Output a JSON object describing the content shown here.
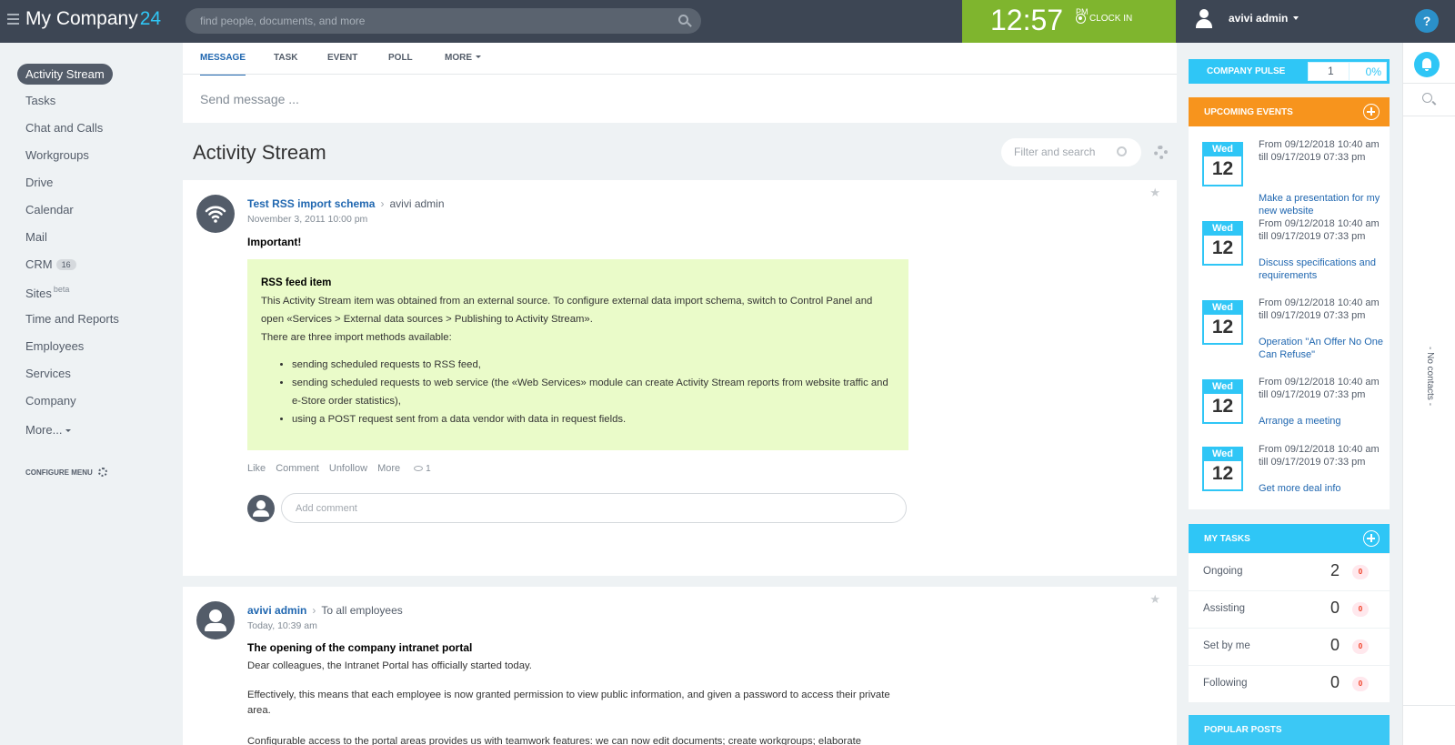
{
  "header": {
    "logo": "My Company",
    "logo_num": "24",
    "search_placeholder": "find people, documents, and more",
    "clock": {
      "time": "12:57",
      "ampm": "PM",
      "clock_in": "CLOCK IN"
    },
    "user_name": "avivi admin",
    "help": "?"
  },
  "menu": {
    "items": [
      {
        "label": "Activity Stream"
      },
      {
        "label": "Tasks"
      },
      {
        "label": "Chat and Calls"
      },
      {
        "label": "Workgroups"
      },
      {
        "label": "Drive"
      },
      {
        "label": "Calendar"
      },
      {
        "label": "Mail"
      },
      {
        "label": "CRM",
        "badge": "16"
      },
      {
        "label": "Sites",
        "sup": "beta"
      },
      {
        "label": "Time and Reports"
      },
      {
        "label": "Employees"
      },
      {
        "label": "Services"
      },
      {
        "label": "Company"
      },
      {
        "label": "More..."
      }
    ],
    "configure": "CONFIGURE MENU"
  },
  "composer": {
    "tabs": [
      "MESSAGE",
      "TASK",
      "EVENT",
      "POLL",
      "MORE"
    ],
    "placeholder": "Send message ..."
  },
  "stream": {
    "title": "Activity Stream",
    "filter_placeholder": "Filter and search"
  },
  "posts": [
    {
      "author": "Test RSS import schema",
      "recipient": "avivi admin",
      "date": "November 3, 2011 10:00 pm",
      "title": "Important!",
      "box_title": "RSS feed item",
      "box_text1": "This Activity Stream item was obtained from an external source. To configure external data import schema, switch to Control Panel and open «Services > External data sources > Publishing to Activity Stream».",
      "box_text2": "There are three import methods available:",
      "bullets": [
        "sending scheduled requests to RSS feed,",
        "sending scheduled requests to web service (the «Web Services» module can create Activity Stream reports from website traffic and e-Store order statistics),",
        "using a POST request sent from a data vendor with data in request fields."
      ],
      "actions": [
        "Like",
        "Comment",
        "Unfollow",
        "More"
      ],
      "views": "1",
      "comment_placeholder": "Add comment"
    },
    {
      "author": "avivi admin",
      "recipient": "To all employees",
      "date": "Today, 10:39 am",
      "title": "The opening of the company intranet portal",
      "para1": "Dear colleagues, the Intranet Portal has officially started today.",
      "para2": "Effectively, this means that each employee is now granted permission to view public information, and given a password to access their private area.",
      "para3": "Configurable access to the portal areas provides us with teamwork features: we can now edit documents; create workgroups; elaborate"
    }
  ],
  "right": {
    "pulse": {
      "label": "COMPANY PULSE",
      "value": "1",
      "percent": "0%"
    },
    "events_title": "UPCOMING EVENTS",
    "events": [
      {
        "day": "Wed",
        "num": "12",
        "when": "From 09/12/2018 10:40 am till 09/17/2019 07:33 pm",
        "title": "Make a presentation for my new website"
      },
      {
        "day": "Wed",
        "num": "12",
        "when": "From 09/12/2018 10:40 am till 09/17/2019 07:33 pm",
        "title": "Discuss specifications and requirements"
      },
      {
        "day": "Wed",
        "num": "12",
        "when": "From 09/12/2018 10:40 am till 09/17/2019 07:33 pm",
        "title": "Operation \"An Offer No One Can Refuse\""
      },
      {
        "day": "Wed",
        "num": "12",
        "when": "From 09/12/2018 10:40 am till 09/17/2019 07:33 pm",
        "title": "Arrange a meeting"
      },
      {
        "day": "Wed",
        "num": "12",
        "when": "From 09/12/2018 10:40 am till 09/17/2019 07:33 pm",
        "title": "Get more deal info"
      }
    ],
    "tasks_title": "MY TASKS",
    "tasks": [
      {
        "label": "Ongoing",
        "count": "2",
        "badge": "0"
      },
      {
        "label": "Assisting",
        "count": "0",
        "badge": "0"
      },
      {
        "label": "Set by me",
        "count": "0",
        "badge": "0"
      },
      {
        "label": "Following",
        "count": "0",
        "badge": "0"
      }
    ],
    "popular_title": "POPULAR POSTS"
  },
  "sidebar_right": {
    "no_contacts": "- No contacts -"
  },
  "colors": {
    "header": "#3d4654",
    "accent": "#2fc6f6",
    "clock": "#7fb52e",
    "events": "#f7941d",
    "link": "#2067b0"
  }
}
